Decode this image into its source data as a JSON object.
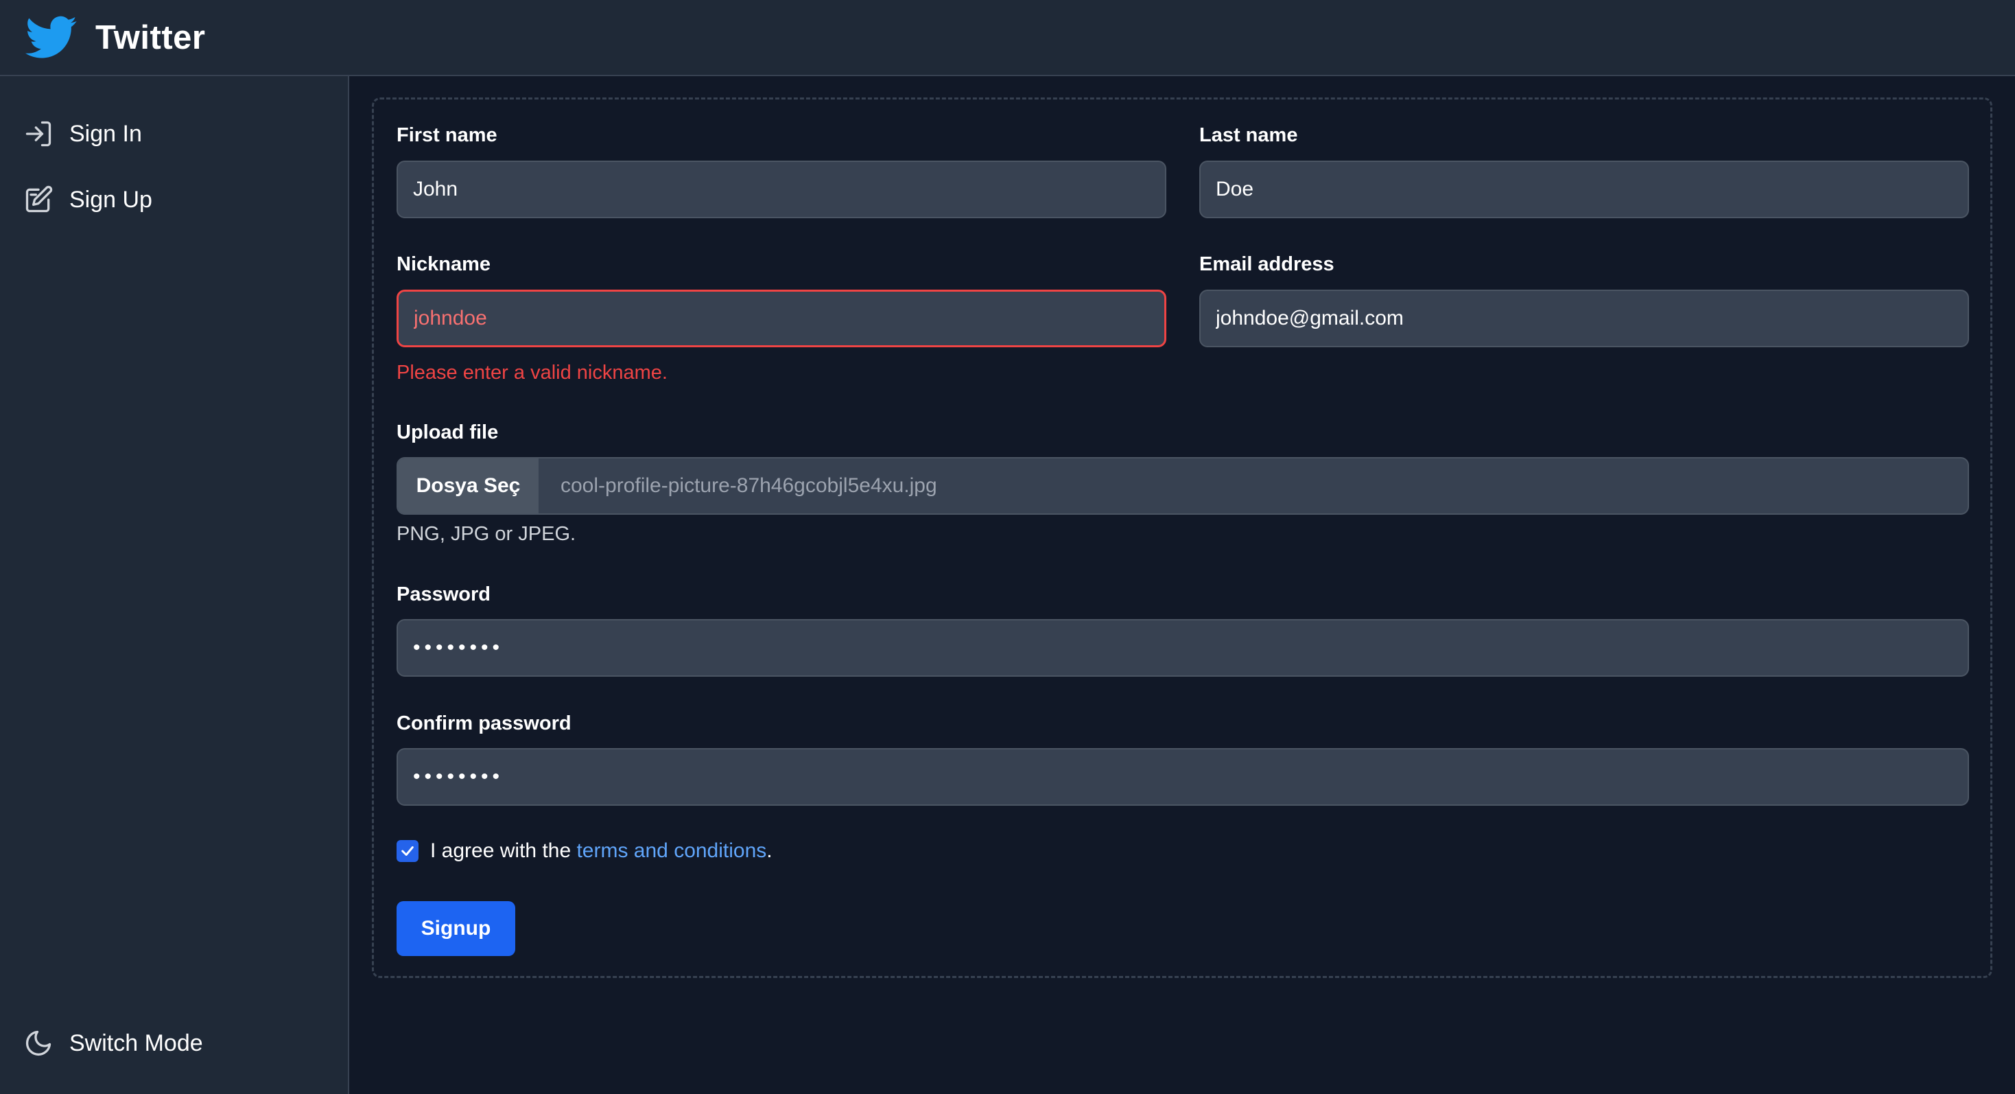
{
  "header": {
    "title": "Twitter",
    "logo_icon": "twitter-bird-icon",
    "accent": "#1d9bf0"
  },
  "sidebar": {
    "items": [
      {
        "label": "Sign In",
        "icon": "sign-in-icon"
      },
      {
        "label": "Sign Up",
        "icon": "sign-up-icon"
      }
    ],
    "switch_mode": {
      "label": "Switch Mode",
      "icon": "moon-icon"
    }
  },
  "form": {
    "first_name": {
      "label": "First name",
      "value": "John"
    },
    "last_name": {
      "label": "Last name",
      "value": "Doe"
    },
    "nickname": {
      "label": "Nickname",
      "value": "johndoe",
      "error": "Please enter a valid nickname.",
      "error_color": "#ef4444"
    },
    "email": {
      "label": "Email address",
      "value": "johndoe@gmail.com"
    },
    "upload": {
      "label": "Upload file",
      "button": "Dosya Seç",
      "filename": "cool-profile-picture-87h46gcobjl5e4xu.jpg",
      "help": "PNG, JPG or JPEG."
    },
    "password": {
      "label": "Password",
      "value": "••••••••"
    },
    "confirm_password": {
      "label": "Confirm password",
      "value": "••••••••"
    },
    "agree": {
      "checked": true,
      "text_before": "I agree with the ",
      "link": "terms and conditions",
      "text_after": "."
    },
    "submit": {
      "label": "Signup",
      "color": "#1d64f2"
    }
  }
}
